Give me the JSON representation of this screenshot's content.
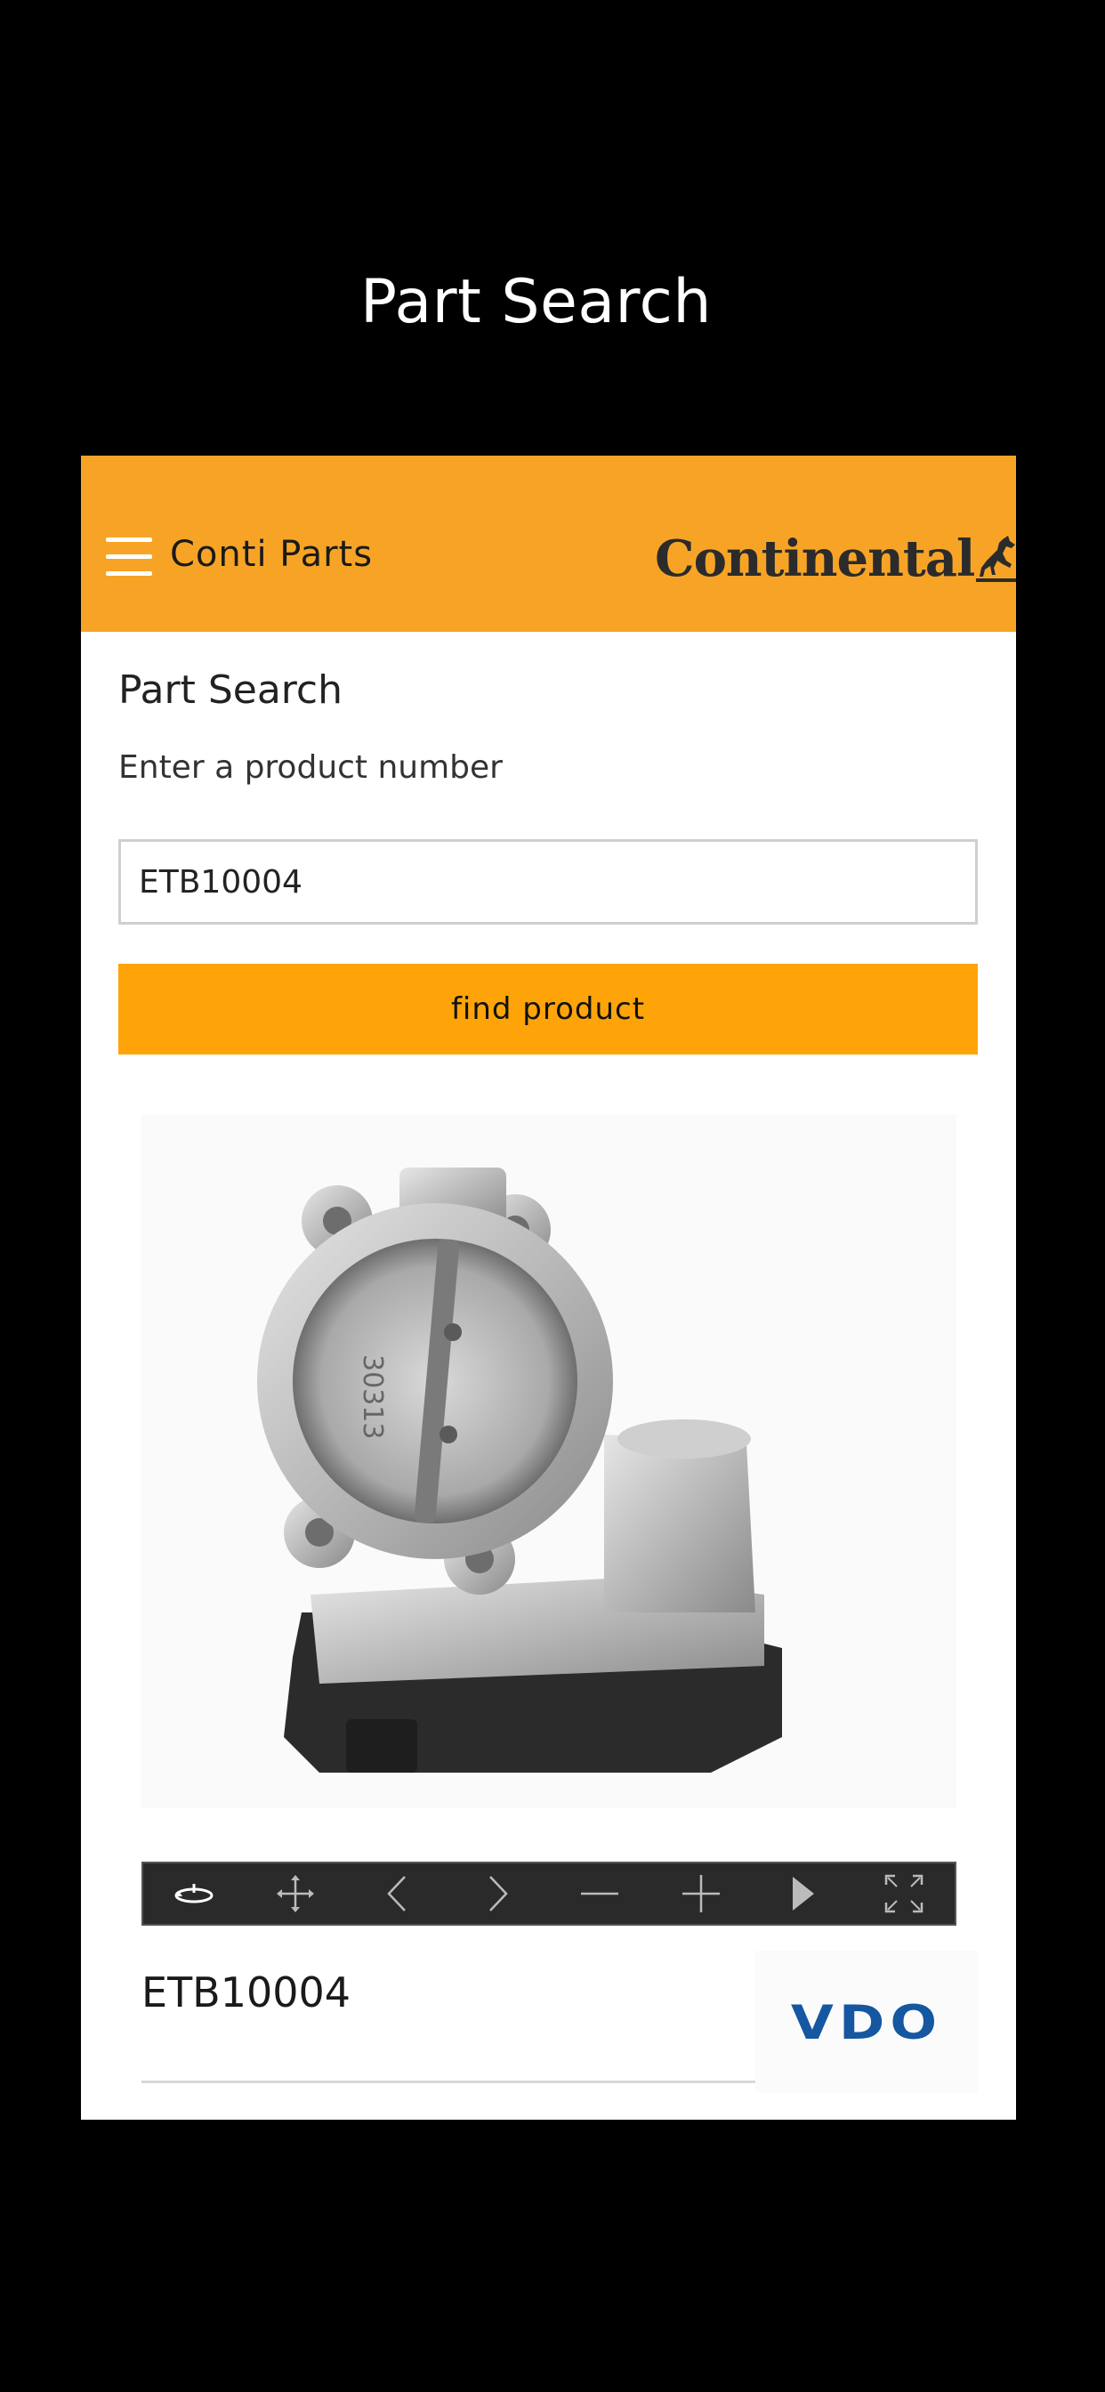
{
  "screen": {
    "title": "Part Search"
  },
  "header": {
    "app_name": "Conti Parts",
    "brand_logo_text": "Continental",
    "background_color": "#f7a426"
  },
  "search": {
    "title": "Part Search",
    "subtitle": "Enter a product number",
    "input_value": "ETB10004",
    "button_label": "find product",
    "button_color": "#ffa408"
  },
  "viewer": {
    "toolbar_icons": [
      "rotate-icon",
      "move-icon",
      "chevron-left-icon",
      "chevron-right-icon",
      "zoom-out-icon",
      "zoom-in-icon",
      "play-icon",
      "fullscreen-icon"
    ]
  },
  "result": {
    "product_number": "ETB10004",
    "brand_logo_text": "VDO",
    "brand_color": "#1557a0"
  }
}
